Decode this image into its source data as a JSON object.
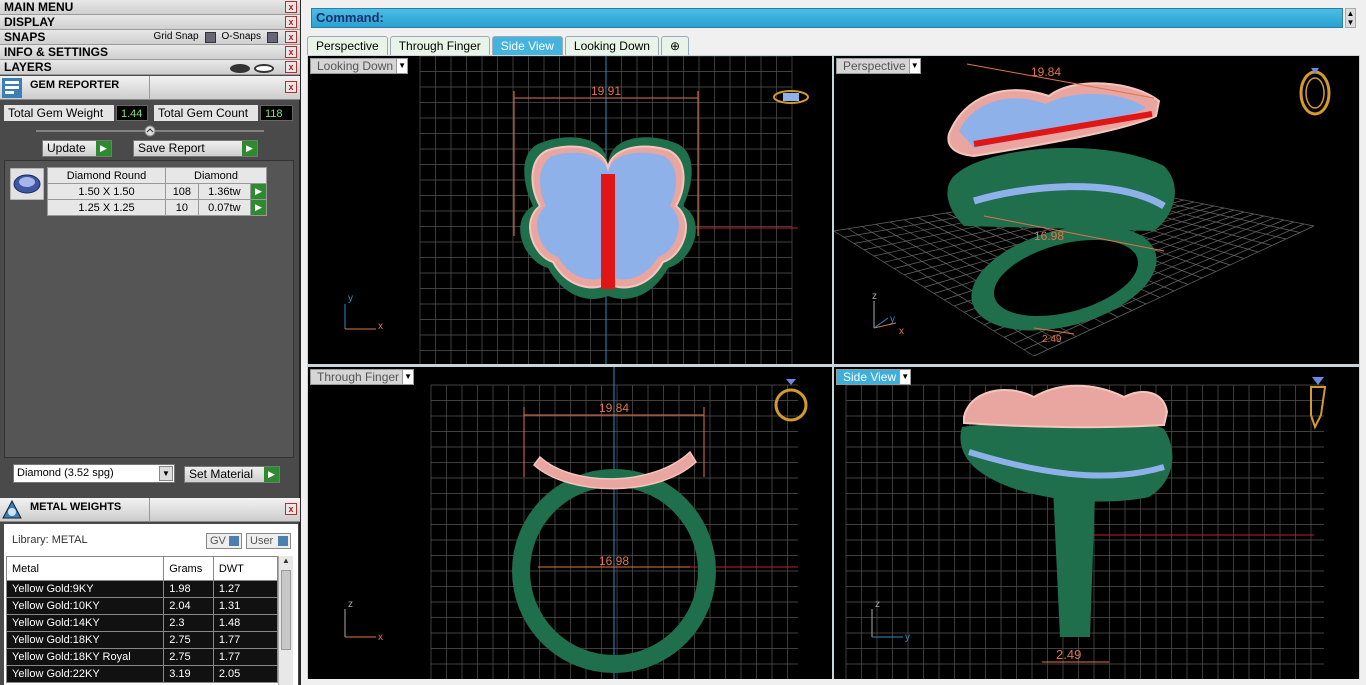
{
  "menubars": {
    "main_menu": "MAIN MENU",
    "display": "DISPLAY",
    "snaps": "SNAPS",
    "grid_snap": "Grid Snap",
    "o_snaps": "O-Snaps",
    "info_settings": "INFO & SETTINGS",
    "layers": "LAYERS",
    "close": "x"
  },
  "gem_reporter": {
    "title": "GEM REPORTER",
    "total_weight_label": "Total Gem Weight",
    "total_weight_value": "1.44",
    "total_count_label": "Total Gem Count",
    "total_count_value": "118",
    "update_label": "Update",
    "save_report_label": "Save Report",
    "table_headers": [
      "Diamond Round",
      "Diamond"
    ],
    "rows": [
      {
        "size": "1.50 X 1.50",
        "count": "108",
        "weight": "1.36tw"
      },
      {
        "size": "1.25 X 1.25",
        "count": "10",
        "weight": "0.07tw"
      }
    ],
    "material_select": "Diamond     (3.52 spg)",
    "set_material_label": "Set Material"
  },
  "metal_weights": {
    "title": "METAL WEIGHTS",
    "library_label": "Library: METAL",
    "gv_label": "GV",
    "user_label": "User",
    "headers": [
      "Metal",
      "Grams",
      "DWT"
    ],
    "rows": [
      {
        "metal": "Yellow Gold:9KY",
        "grams": "1.98",
        "dwt": "1.27"
      },
      {
        "metal": "Yellow Gold:10KY",
        "grams": "2.04",
        "dwt": "1.31"
      },
      {
        "metal": "Yellow Gold:14KY",
        "grams": "2.3",
        "dwt": "1.48"
      },
      {
        "metal": "Yellow Gold:18KY",
        "grams": "2.75",
        "dwt": "1.77"
      },
      {
        "metal": "Yellow Gold:18KY Royal",
        "grams": "2.75",
        "dwt": "1.77"
      },
      {
        "metal": "Yellow Gold:22KY",
        "grams": "3.19",
        "dwt": "2.05"
      }
    ]
  },
  "command": {
    "label": "Command:"
  },
  "tabs": [
    "Perspective",
    "Through Finger",
    "Side View",
    "Looking Down"
  ],
  "active_tab": "Side View",
  "viewports": {
    "top_left": {
      "label": "Looking Down",
      "dimension": "19.91",
      "axis_h": "x",
      "axis_v": "y"
    },
    "top_right": {
      "label": "Perspective",
      "dimension_top": "19.84",
      "dimension_inner": "16.98",
      "dimension_bottom": "2.49",
      "axis_h": "x",
      "axis_v": "z",
      "axis_d": "y"
    },
    "bottom_left": {
      "label": "Through Finger",
      "dimension_top": "19.84",
      "dimension_inner": "16.98",
      "axis_h": "x",
      "axis_v": "z"
    },
    "bottom_right": {
      "label": "Side View",
      "dimension_bottom": "2.49",
      "axis_h": "y",
      "axis_v": "z"
    }
  },
  "colors": {
    "accent": "#3eaedb",
    "ring_green": "#1f6e4c",
    "gold": "#c89a2a",
    "dimension": "#e2734a",
    "grid": "#5a5a5a"
  }
}
